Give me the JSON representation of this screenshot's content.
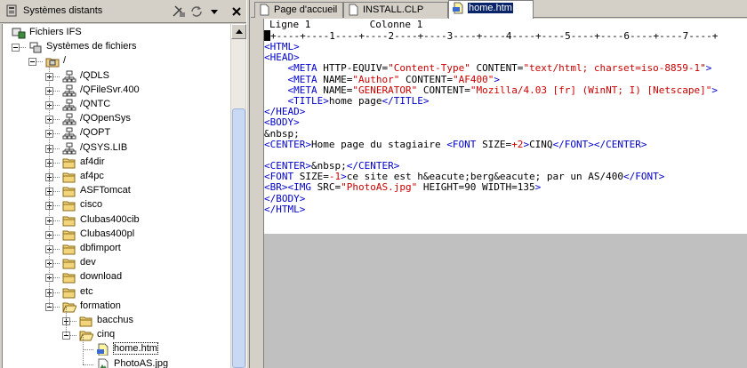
{
  "left_panel": {
    "title": "Systèmes distants",
    "title_icon": "remote-systems-icon",
    "toolbar": [
      "remove-system-icon",
      "refresh-icon",
      "dropdown-icon",
      "close-icon"
    ],
    "tree": [
      {
        "label": "Fichiers IFS",
        "icon": "ifs-files-icon",
        "level": 1,
        "expanded": true
      },
      {
        "label": "Systèmes de fichiers",
        "icon": "filesystems-icon",
        "level": 2,
        "expanded": true
      },
      {
        "label": "/",
        "icon": "root-folder-icon",
        "level": 3,
        "expanded": true
      },
      {
        "label": "/QDLS",
        "icon": "network-folder-icon",
        "level": 4,
        "expander": "plus"
      },
      {
        "label": "/QFileSvr.400",
        "icon": "network-folder-icon",
        "level": 4,
        "expander": "plus"
      },
      {
        "label": "/QNTC",
        "icon": "network-folder-icon",
        "level": 4,
        "expander": "plus"
      },
      {
        "label": "/QOpenSys",
        "icon": "network-folder-icon",
        "level": 4,
        "expander": "plus"
      },
      {
        "label": "/QOPT",
        "icon": "network-folder-icon",
        "level": 4,
        "expander": "plus"
      },
      {
        "label": "/QSYS.LIB",
        "icon": "network-folder-icon",
        "level": 4,
        "expander": "plus"
      },
      {
        "label": "af4dir",
        "icon": "folder-icon",
        "level": 4,
        "expander": "plus"
      },
      {
        "label": "af4pc",
        "icon": "folder-icon",
        "level": 4,
        "expander": "plus"
      },
      {
        "label": "ASFTomcat",
        "icon": "folder-icon",
        "level": 4,
        "expander": "plus"
      },
      {
        "label": "cisco",
        "icon": "folder-icon",
        "level": 4,
        "expander": "plus"
      },
      {
        "label": "Clubas400cib",
        "icon": "folder-icon",
        "level": 4,
        "expander": "plus"
      },
      {
        "label": "Clubas400pl",
        "icon": "folder-icon",
        "level": 4,
        "expander": "plus"
      },
      {
        "label": "dbfimport",
        "icon": "folder-icon",
        "level": 4,
        "expander": "plus"
      },
      {
        "label": "dev",
        "icon": "folder-icon",
        "level": 4,
        "expander": "plus"
      },
      {
        "label": "download",
        "icon": "folder-icon",
        "level": 4,
        "expander": "plus"
      },
      {
        "label": "etc",
        "icon": "folder-icon",
        "level": 4,
        "expander": "plus"
      },
      {
        "label": "formation",
        "icon": "open-folder-icon",
        "level": 4,
        "expander": "minus"
      },
      {
        "label": "bacchus",
        "icon": "folder-icon",
        "level": 5,
        "expander": "plus"
      },
      {
        "label": "cinq",
        "icon": "open-folder-icon",
        "level": 5,
        "expander": "minus"
      },
      {
        "label": "home.htm",
        "icon": "html-file-icon",
        "level": 6,
        "selected": true
      },
      {
        "label": "PhotoAS.jpg",
        "icon": "image-file-icon",
        "level": 6
      }
    ]
  },
  "tabs": [
    {
      "label": "Page d'accueil",
      "icon": "page-icon",
      "active": false
    },
    {
      "label": "INSTALL.CLP",
      "icon": "page-icon",
      "active": false
    },
    {
      "label": "home.htm",
      "icon": "html-file-icon",
      "active": true
    }
  ],
  "editor": {
    "line_label": "Ligne 1",
    "column_label": "Colonne 1",
    "ruler": "+----+----1----+----2----+----3----+----4----+----5----+----6----+----7----+",
    "code_lines": [
      [
        [
          "t",
          "<HTML>"
        ]
      ],
      [
        [
          "t",
          "<HEAD>"
        ]
      ],
      [
        [
          "x",
          "    "
        ],
        [
          "t",
          "<META "
        ],
        [
          "a",
          "HTTP-EQUIV="
        ],
        [
          "v",
          "\"Content-Type\""
        ],
        [
          "a",
          " CONTENT="
        ],
        [
          "v",
          "\"text/html; charset=iso-8859-1\""
        ],
        [
          "t",
          ">"
        ]
      ],
      [
        [
          "x",
          "    "
        ],
        [
          "t",
          "<META "
        ],
        [
          "a",
          "NAME="
        ],
        [
          "v",
          "\"Author\""
        ],
        [
          "a",
          " CONTENT="
        ],
        [
          "v",
          "\"AF400\""
        ],
        [
          "t",
          ">"
        ]
      ],
      [
        [
          "x",
          "    "
        ],
        [
          "t",
          "<META "
        ],
        [
          "a",
          "NAME="
        ],
        [
          "v",
          "\"GENERATOR\""
        ],
        [
          "a",
          " CONTENT="
        ],
        [
          "v",
          "\"Mozilla/4.03 [fr] (WinNT; I) [Netscape]\""
        ],
        [
          "t",
          ">"
        ]
      ],
      [
        [
          "x",
          "    "
        ],
        [
          "t",
          "<TITLE>"
        ],
        [
          "x",
          "home page"
        ],
        [
          "t",
          "</TITLE>"
        ]
      ],
      [
        [
          "t",
          "</HEAD>"
        ]
      ],
      [
        [
          "t",
          "<BODY>"
        ]
      ],
      [
        [
          "x",
          "&nbsp;"
        ]
      ],
      [
        [
          "t",
          "<CENTER>"
        ],
        [
          "x",
          "Home page du stagiaire "
        ],
        [
          "t",
          "<FONT "
        ],
        [
          "a",
          "SIZE="
        ],
        [
          "v",
          "+2"
        ],
        [
          "t",
          ">"
        ],
        [
          "x",
          "CINQ"
        ],
        [
          "t",
          "</FONT></CENTER>"
        ]
      ],
      [
        [
          "x",
          ""
        ]
      ],
      [
        [
          "t",
          "<CENTER>"
        ],
        [
          "x",
          "&nbsp;"
        ],
        [
          "t",
          "</CENTER>"
        ]
      ],
      [
        [
          "t",
          "<FONT "
        ],
        [
          "a",
          "SIZE="
        ],
        [
          "v",
          "-1"
        ],
        [
          "t",
          ">"
        ],
        [
          "x",
          "ce site est h&eacute;berg&eacute; par un AS/400"
        ],
        [
          "t",
          "</FONT>"
        ]
      ],
      [
        [
          "t",
          "<BR><IMG "
        ],
        [
          "a",
          "SRC="
        ],
        [
          "v",
          "\"PhotoAS.jpg\""
        ],
        [
          "a",
          " HEIGHT="
        ],
        [
          "x",
          "90"
        ],
        [
          "a",
          " WIDTH="
        ],
        [
          "x",
          "135"
        ],
        [
          "t",
          ">"
        ]
      ],
      [
        [
          "t",
          "</BODY>"
        ]
      ],
      [
        [
          "t",
          "</HTML>"
        ]
      ]
    ]
  },
  "colors": {
    "tag": "#0000cc",
    "value": "#cc0000",
    "selection": "#0a246a"
  }
}
